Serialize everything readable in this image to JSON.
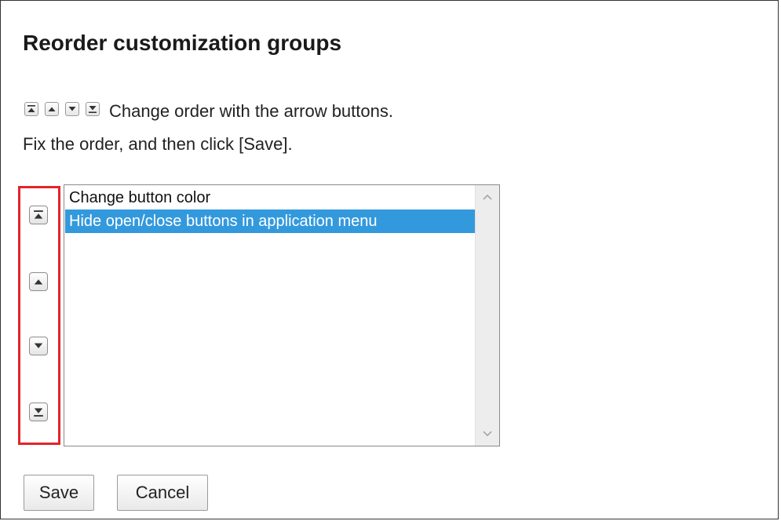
{
  "dialog": {
    "title": "Reorder customization groups",
    "hint_line1": "Change order with the arrow buttons.",
    "hint_line2": "Fix the order, and then click [Save]."
  },
  "inline_icons": [
    "move-to-top-icon",
    "move-up-icon",
    "move-down-icon",
    "move-to-bottom-icon"
  ],
  "side_buttons": [
    "move-to-top-icon",
    "move-up-icon",
    "move-down-icon",
    "move-to-bottom-icon"
  ],
  "listbox": {
    "items": [
      {
        "label": "Change button color",
        "selected": false
      },
      {
        "label": "Hide open/close buttons in application menu",
        "selected": true
      }
    ]
  },
  "actions": {
    "save_label": "Save",
    "cancel_label": "Cancel"
  },
  "colors": {
    "highlight_border": "#e2242a",
    "selection": "#3399dd"
  }
}
